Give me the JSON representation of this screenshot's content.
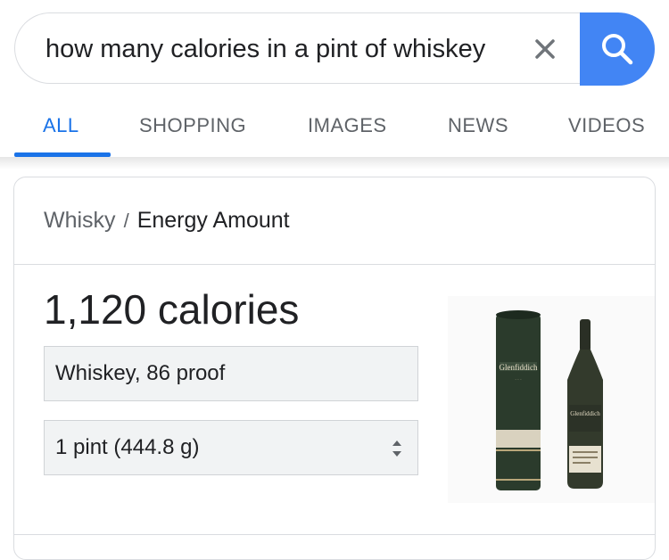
{
  "search": {
    "query": "how many calories in a pint of whiskey"
  },
  "tabs": [
    {
      "label": "ALL",
      "active": true
    },
    {
      "label": "SHOPPING",
      "active": false
    },
    {
      "label": "IMAGES",
      "active": false
    },
    {
      "label": "NEWS",
      "active": false
    },
    {
      "label": "VIDEOS",
      "active": false
    }
  ],
  "card": {
    "breadcrumb_parent": "Whisky",
    "breadcrumb_separator": "/",
    "breadcrumb_current": "Energy Amount",
    "result_value": "1,120 calories",
    "food_select": "Whiskey, 86 proof",
    "quantity_select": "1 pint (444.8 g)",
    "image_icon": "whisky-bottle-and-tube-icon",
    "image_label": "Glenfiddich"
  },
  "colors": {
    "accent": "#1a73e8",
    "search_button": "#4285f4",
    "bottle_green": "#2c3a2b"
  }
}
